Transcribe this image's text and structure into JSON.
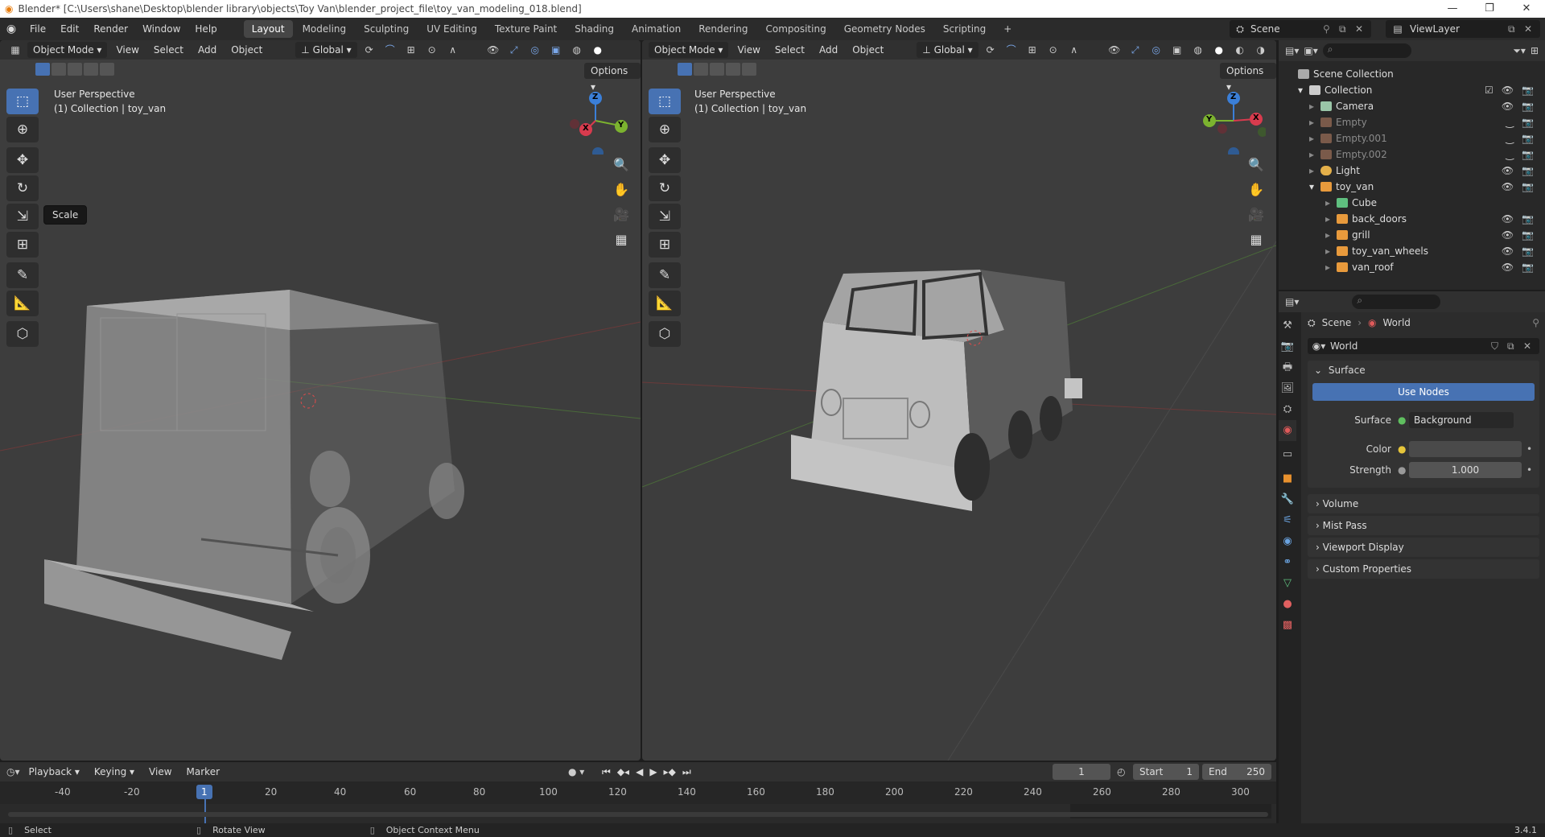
{
  "titlebar": {
    "title": "Blender* [C:\\Users\\shane\\Desktop\\blender library\\objects\\Toy Van\\blender_project_file\\toy_van_modeling_018.blend]",
    "min": "—",
    "max": "❐",
    "close": "✕"
  },
  "menu": {
    "file": "File",
    "edit": "Edit",
    "render": "Render",
    "window": "Window",
    "help": "Help"
  },
  "workspaces": [
    "Layout",
    "Modeling",
    "Sculpting",
    "UV Editing",
    "Texture Paint",
    "Shading",
    "Animation",
    "Rendering",
    "Compositing",
    "Geometry Nodes",
    "Scripting"
  ],
  "scene_selector": {
    "scene": "Scene",
    "viewlayer": "ViewLayer"
  },
  "viewport_header": {
    "mode": "Object Mode",
    "view": "View",
    "select": "Select",
    "add": "Add",
    "object": "Object",
    "orientation": "Global",
    "options": "Options"
  },
  "viewport_left": {
    "perspective": "User Perspective",
    "collection": "(1) Collection | toy_van",
    "tooltip": "Scale"
  },
  "viewport_right": {
    "perspective": "User Perspective",
    "collection": "(1) Collection | toy_van"
  },
  "gizmo": {
    "x": "X",
    "y": "Y",
    "z": "Z"
  },
  "outliner": {
    "root": "Scene Collection",
    "collection": "Collection",
    "items": [
      {
        "name": "Camera",
        "color": "#9ac6a8"
      },
      {
        "name": "Empty",
        "color": "#888"
      },
      {
        "name": "Empty.001",
        "color": "#888"
      },
      {
        "name": "Empty.002",
        "color": "#888"
      },
      {
        "name": "Light",
        "color": "#e4b04a"
      },
      {
        "name": "toy_van",
        "color": "#e89a3c"
      }
    ],
    "children": [
      "Cube",
      "back_doors",
      "grill",
      "toy_van_wheels",
      "van_roof"
    ]
  },
  "properties": {
    "breadcrumb_scene": "Scene",
    "breadcrumb_world": "World",
    "world_name": "World",
    "surface_panel": "Surface",
    "use_nodes": "Use Nodes",
    "surface_label": "Surface",
    "surface_value": "Background",
    "color_label": "Color",
    "strength_label": "Strength",
    "strength_value": "1.000",
    "panels": [
      "Volume",
      "Mist Pass",
      "Viewport Display",
      "Custom Properties"
    ]
  },
  "timeline": {
    "playback": "Playback",
    "keying": "Keying",
    "view": "View",
    "marker": "Marker",
    "current_frame": "1",
    "start_label": "Start",
    "start": "1",
    "end_label": "End",
    "end": "250",
    "ticks": [
      "-40",
      "-20",
      "1",
      "20",
      "40",
      "60",
      "80",
      "100",
      "120",
      "140",
      "160",
      "180",
      "200",
      "220",
      "240",
      "260",
      "280",
      "300"
    ]
  },
  "statusbar": {
    "select": "Select",
    "rotate": "Rotate View",
    "context": "Object Context Menu",
    "version": "3.4.1"
  }
}
